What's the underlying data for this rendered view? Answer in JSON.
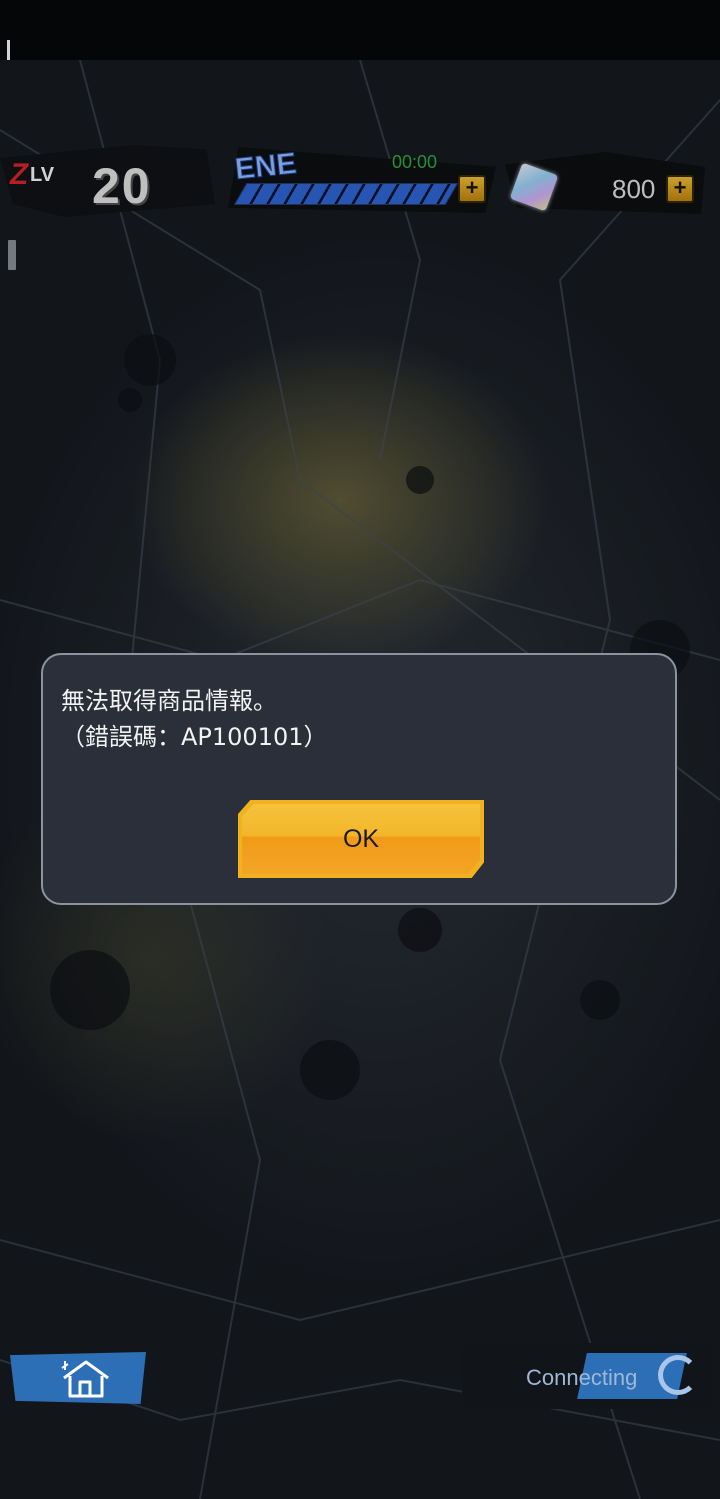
{
  "hud": {
    "level_prefix": "Z",
    "level_tag": "LV",
    "level": "20",
    "energy_label": "ENE",
    "energy_timer": "00:00",
    "energy_fill_percent": 100,
    "gem_count": "800",
    "plus_symbol": "+"
  },
  "dialog": {
    "message_line1": "無法取得商品情報。",
    "message_line2": "（錯誤碼：AP100101）",
    "ok_label": "OK"
  },
  "footer": {
    "connecting_text": "Connecting"
  },
  "icons": {
    "gem": "gem-icon",
    "home": "home-icon",
    "spinner": "loading-spinner-icon",
    "plus": "plus-icon"
  },
  "colors": {
    "accent_yellow": "#f0b21f",
    "energy_blue": "#2f6ad8",
    "timer_green": "#2fb040",
    "level_red": "#e0242d",
    "dialog_bg": "#2a2f39"
  }
}
